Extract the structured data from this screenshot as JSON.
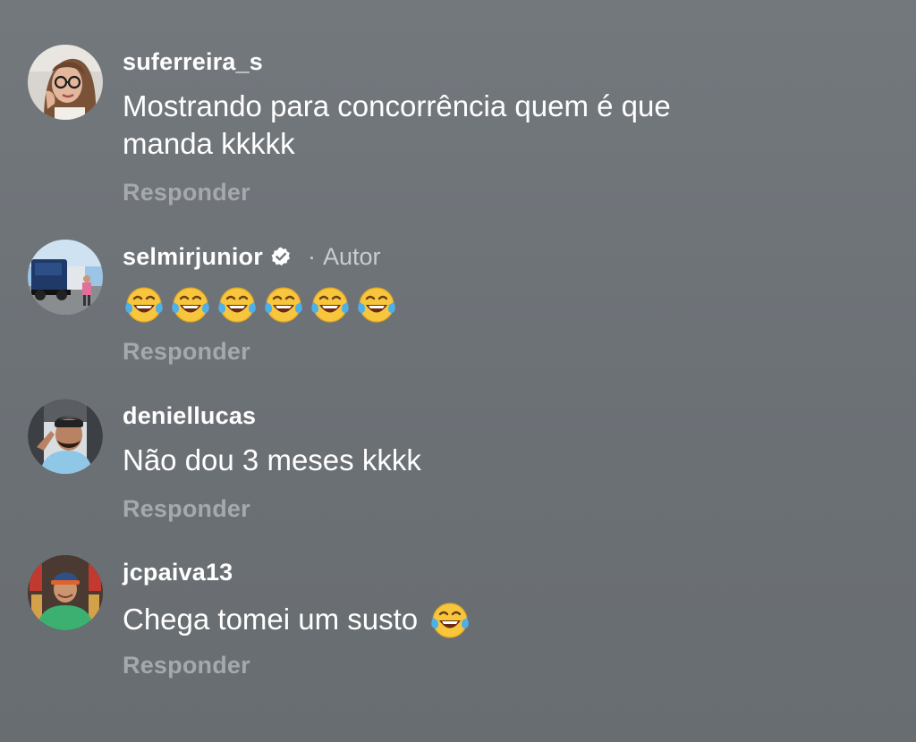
{
  "comments": [
    {
      "username": "suferreira_s",
      "text": "Mostrando para concorrência quem é que\nmanda kkkkk",
      "reply_label": "Responder",
      "verified": false,
      "author": false
    },
    {
      "username": "selmirjunior",
      "separator": "·",
      "author_label": "Autor",
      "text_icons": [
        "laugh-cry-emoji",
        "laugh-cry-emoji",
        "laugh-cry-emoji",
        "laugh-cry-emoji",
        "laugh-cry-emoji",
        "laugh-cry-emoji"
      ],
      "reply_label": "Responder",
      "verified": true,
      "author": true
    },
    {
      "username": "deniellucas",
      "text": "Não dou 3 meses kkkk",
      "reply_label": "Responder",
      "verified": false,
      "author": false
    },
    {
      "username": "jcpaiva13",
      "text": "Chega tomei um susto",
      "trailing_icon": "laugh-cry-emoji",
      "reply_label": "Responder",
      "verified": false,
      "author": false
    }
  ],
  "colors": {
    "background": "#6e7378",
    "username": "#ffffff",
    "text": "#ffffff",
    "reply": "#a5a9ae",
    "author_tag": "#c9ccd0",
    "verified_badge": "#ffffff"
  }
}
